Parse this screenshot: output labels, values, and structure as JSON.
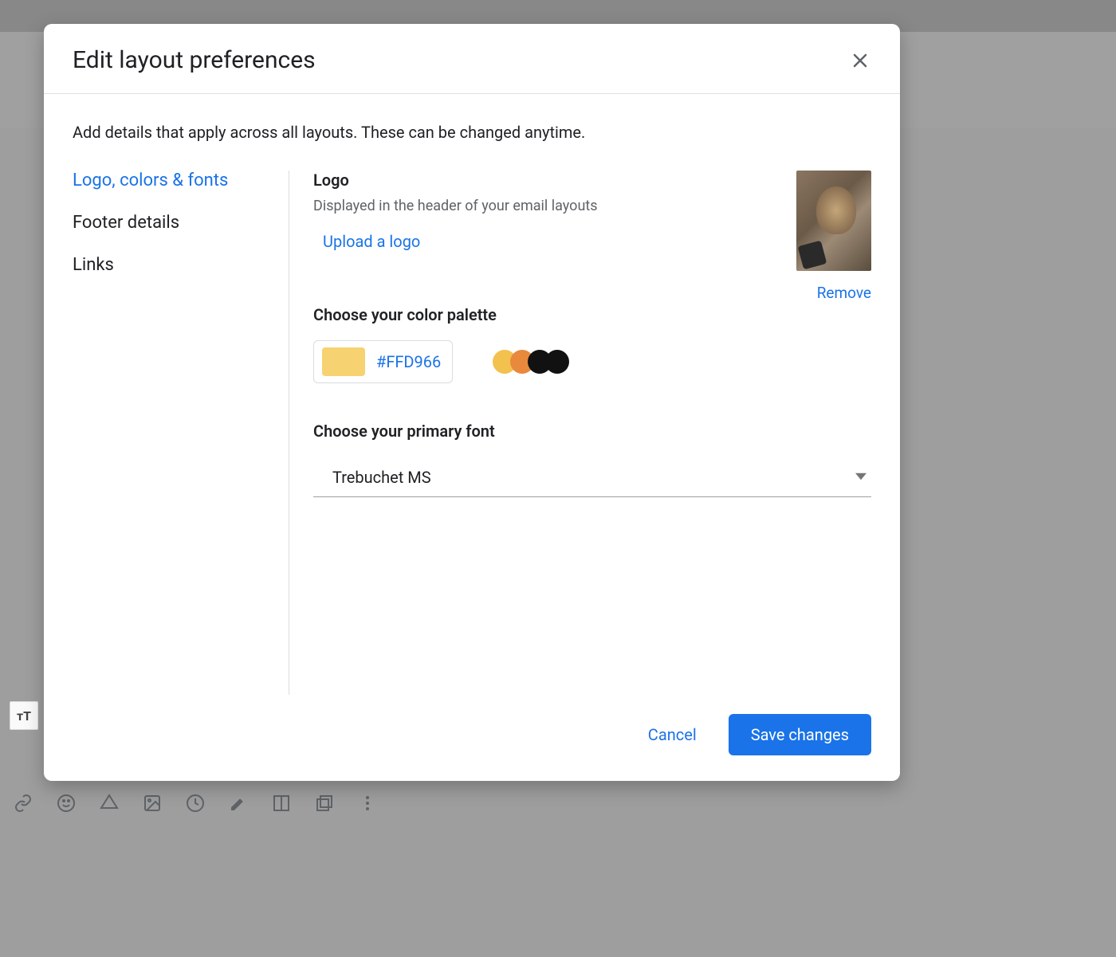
{
  "modal": {
    "title": "Edit layout preferences",
    "description": "Add details that apply across all layouts. These can be changed anytime."
  },
  "sidebar": {
    "items": [
      {
        "label": "Logo, colors & fonts",
        "active": true
      },
      {
        "label": "Footer details",
        "active": false
      },
      {
        "label": "Links",
        "active": false
      }
    ]
  },
  "logo": {
    "heading": "Logo",
    "subtitle": "Displayed in the header of your email layouts",
    "upload_label": "Upload a logo",
    "remove_label": "Remove"
  },
  "palette": {
    "heading": "Choose your color palette",
    "hex": "#FFD966",
    "swatch": "#F7D271",
    "preview": [
      "#F2C14E",
      "#E8893C",
      "#111111",
      "#111111"
    ]
  },
  "font": {
    "heading": "Choose your primary font",
    "selected": "Trebuchet MS"
  },
  "footer": {
    "cancel": "Cancel",
    "save": "Save changes"
  },
  "bg": {
    "tt": "тT"
  },
  "colors": {
    "primary_blue": "#1a73e8",
    "text_primary": "#202124",
    "text_secondary": "#5f6368"
  }
}
